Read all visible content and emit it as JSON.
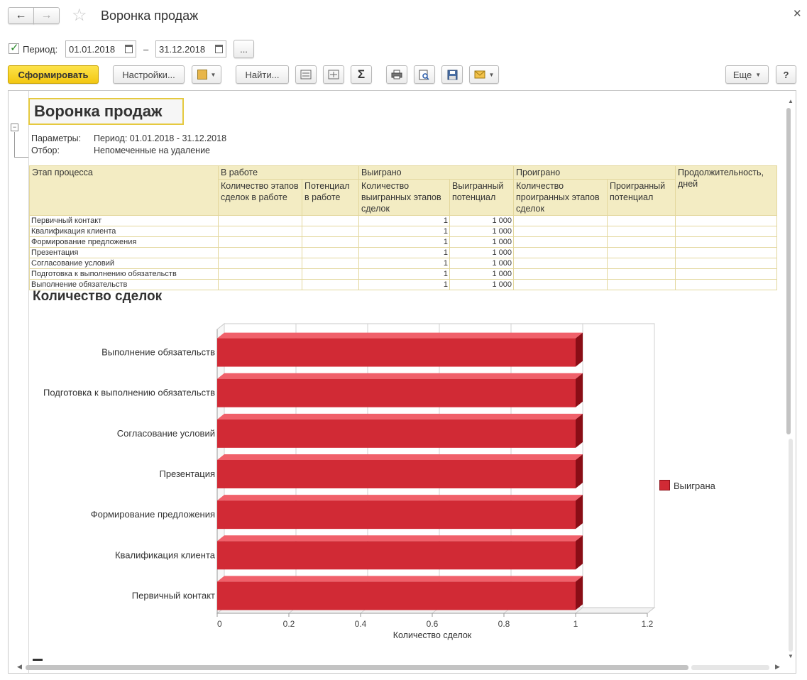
{
  "window": {
    "title": "Воронка продаж"
  },
  "filter": {
    "period_checked": true,
    "period_label": "Период:",
    "date_from": "01.01.2018",
    "dash": "–",
    "date_to": "31.12.2018",
    "more_label": "..."
  },
  "toolbar": {
    "generate": "Сформировать",
    "settings": "Настройки...",
    "find": "Найти...",
    "sum_symbol": "Σ",
    "more": "Еще",
    "help": "?"
  },
  "report": {
    "title": "Воронка продаж",
    "params_label": "Параметры:",
    "params_value": "Период: 01.01.2018 - 31.12.2018",
    "filter_label": "Отбор:",
    "filter_value": "Непомеченные на удаление",
    "headers": {
      "stage": "Этап процесса",
      "in_work": "В работе",
      "won": "Выиграно",
      "lost": "Проиграно",
      "duration": "Продолжительность, дней",
      "in_work_count": "Количество этапов сделок в работе",
      "in_work_potential": "Потенциал в работе",
      "won_count": "Количество выигранных этапов сделок",
      "won_potential": "Выигранный потенциал",
      "lost_count": "Количество проигранных этапов сделок",
      "lost_potential": "Проигранный потенциал"
    },
    "rows": [
      {
        "stage": "Первичный контакт",
        "in_work_count": "",
        "in_work_potential": "",
        "won_count": "1",
        "won_potential": "1 000",
        "lost_count": "",
        "lost_potential": "",
        "duration": ""
      },
      {
        "stage": "Квалификация клиента",
        "in_work_count": "",
        "in_work_potential": "",
        "won_count": "1",
        "won_potential": "1 000",
        "lost_count": "",
        "lost_potential": "",
        "duration": ""
      },
      {
        "stage": "Формирование предложения",
        "in_work_count": "",
        "in_work_potential": "",
        "won_count": "1",
        "won_potential": "1 000",
        "lost_count": "",
        "lost_potential": "",
        "duration": ""
      },
      {
        "stage": "Презентация",
        "in_work_count": "",
        "in_work_potential": "",
        "won_count": "1",
        "won_potential": "1 000",
        "lost_count": "",
        "lost_potential": "",
        "duration": ""
      },
      {
        "stage": "Согласование условий",
        "in_work_count": "",
        "in_work_potential": "",
        "won_count": "1",
        "won_potential": "1 000",
        "lost_count": "",
        "lost_potential": "",
        "duration": ""
      },
      {
        "stage": "Подготовка к выполнению обязательств",
        "in_work_count": "",
        "in_work_potential": "",
        "won_count": "1",
        "won_potential": "1 000",
        "lost_count": "",
        "lost_potential": "",
        "duration": ""
      },
      {
        "stage": "Выполнение обязательств",
        "in_work_count": "",
        "in_work_potential": "",
        "won_count": "1",
        "won_potential": "1 000",
        "lost_count": "",
        "lost_potential": "",
        "duration": ""
      }
    ]
  },
  "chart_data": {
    "type": "bar",
    "orientation": "horizontal",
    "title": "Количество сделок",
    "xlabel": "Количество сделок",
    "ylabel": "",
    "categories": [
      "Выполнение обязательств",
      "Подготовка к выполнению обязательств",
      "Согласование условий",
      "Презентация",
      "Формирование предложения",
      "Квалификация клиента",
      "Первичный контакт"
    ],
    "series": [
      {
        "name": "Выиграна",
        "values": [
          1,
          1,
          1,
          1,
          1,
          1,
          1
        ],
        "color": "#d12a35"
      }
    ],
    "xlim": [
      0,
      1.2
    ],
    "xticks": [
      "0",
      "0.2",
      "0.4",
      "0.6",
      "0.8",
      "1",
      "1.2"
    ],
    "grid": true,
    "legend": "right"
  },
  "colors": {
    "accent_yellow": "#f3c712",
    "table_header_bg": "#f3ecc3",
    "bar_red": "#d12a35"
  },
  "icons": [
    "arrow-left-icon",
    "arrow-right-icon",
    "star-icon",
    "close-icon",
    "checkbox-icon",
    "calendar-icon",
    "variants-icon",
    "print-icon",
    "preview-icon",
    "save-icon",
    "email-icon",
    "collapse-icon"
  ]
}
